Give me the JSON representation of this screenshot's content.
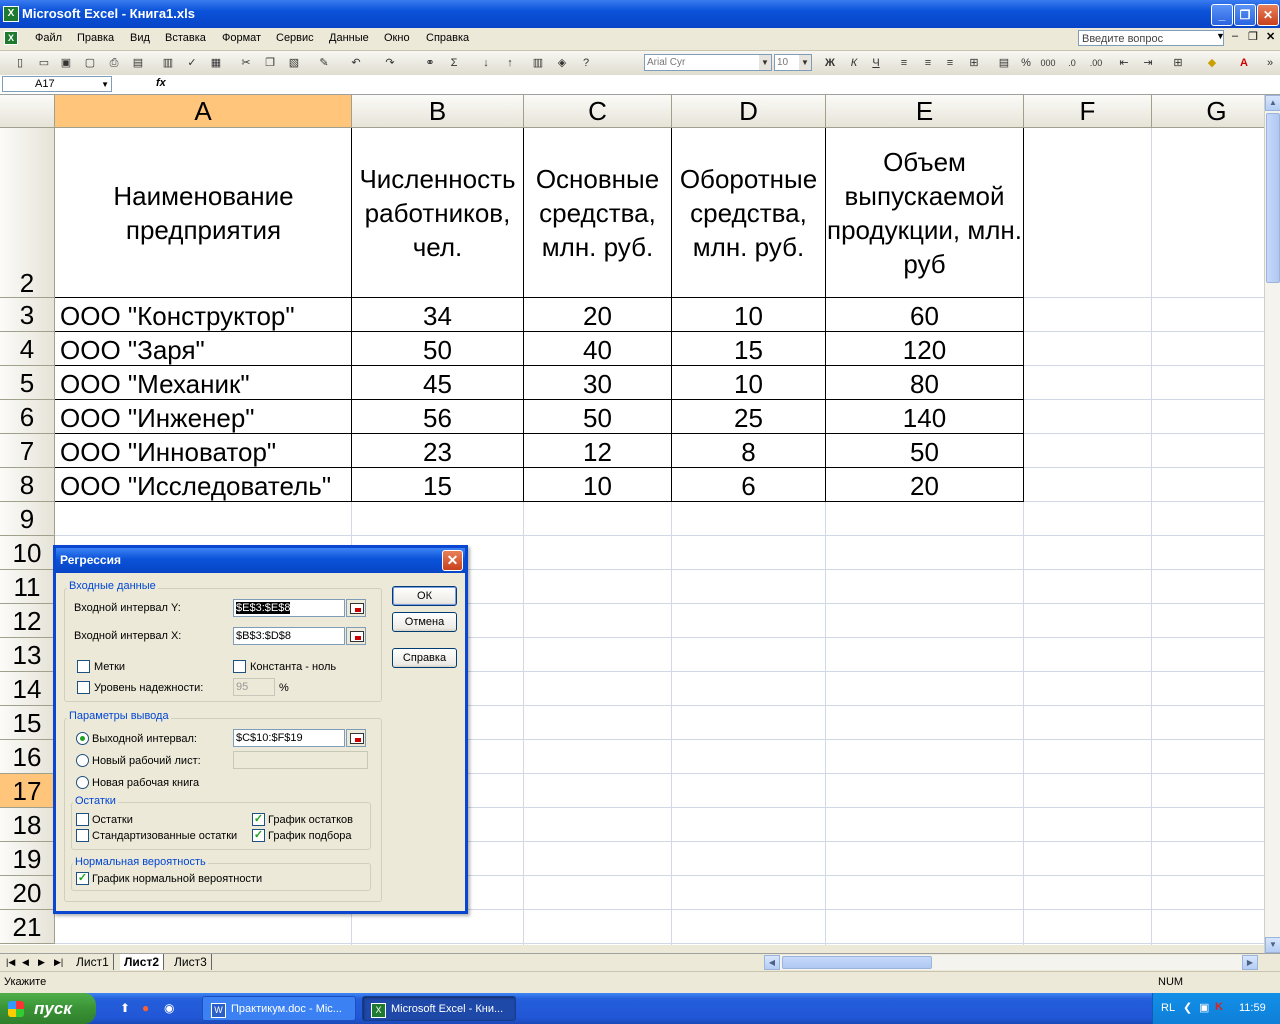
{
  "window": {
    "title": "Microsoft Excel - Книга1.xls"
  },
  "menu": {
    "items": [
      "Файл",
      "Правка",
      "Вид",
      "Вставка",
      "Формат",
      "Сервис",
      "Данные",
      "Окно",
      "Справка"
    ],
    "help_placeholder": "Введите вопрос"
  },
  "toolbar": {
    "font_name": "Arial Cyr",
    "font_size": "10"
  },
  "formula_bar": {
    "name_box": "A17",
    "fx": "fx"
  },
  "columns": [
    "A",
    "B",
    "C",
    "D",
    "E",
    "F",
    "G"
  ],
  "rows": [
    "2",
    "3",
    "4",
    "5",
    "6",
    "7",
    "8",
    "9",
    "10",
    "11",
    "12",
    "13",
    "14",
    "15",
    "16",
    "17",
    "18",
    "19",
    "20",
    "21"
  ],
  "table": {
    "headers": [
      "Наименование предприятия",
      "Численность работников, чел.",
      "Основные средства, млн. руб.",
      "Оборотные средства, млн. руб.",
      "Объем выпускаемой продукции, млн. руб"
    ],
    "rows": [
      [
        "ООО \"Конструктор\"",
        "34",
        "20",
        "10",
        "60"
      ],
      [
        "ООО \"Заря\"",
        "50",
        "40",
        "15",
        "120"
      ],
      [
        "ООО \"Механик\"",
        "45",
        "30",
        "10",
        "80"
      ],
      [
        "ООО \"Инженер\"",
        "56",
        "50",
        "25",
        "140"
      ],
      [
        "ООО \"Инноватор\"",
        "23",
        "12",
        "8",
        "50"
      ],
      [
        "ООО \"Исследователь\"",
        "15",
        "10",
        "6",
        "20"
      ]
    ]
  },
  "sheets": [
    "Лист1",
    "Лист2",
    "Лист3"
  ],
  "status": {
    "left": "Укажите",
    "num": "NUM"
  },
  "dialog": {
    "title": "Регрессия",
    "input_group": "Входные данные",
    "y_label": "Входной интервал Y:",
    "y_value": "$E$3:$E$8",
    "x_label": "Входной интервал X:",
    "x_value": "$B$3:$D$8",
    "labels_chk": "Метки",
    "const_chk": "Константа - ноль",
    "conf_chk": "Уровень надежности:",
    "conf_value": "95",
    "percent": "%",
    "output_group": "Параметры вывода",
    "out_range": "Выходной интервал:",
    "out_range_value": "$C$10:$F$19",
    "new_sheet": "Новый рабочий лист:",
    "new_book": "Новая рабочая книга",
    "resid_group": "Остатки",
    "resid": "Остатки",
    "std_resid": "Стандартизованные остатки",
    "resid_plot": "График остатков",
    "fit_plot": "График подбора",
    "normal_group": "Нормальная вероятность",
    "normal_plot": "График нормальной вероятности",
    "ok": "ОК",
    "cancel": "Отмена",
    "help": "Справка"
  },
  "taskbar": {
    "start": "пуск",
    "tasks": [
      "Практикум.doc - Mic...",
      "Microsoft Excel - Кни..."
    ],
    "lang": "RL",
    "time": "11:59"
  }
}
